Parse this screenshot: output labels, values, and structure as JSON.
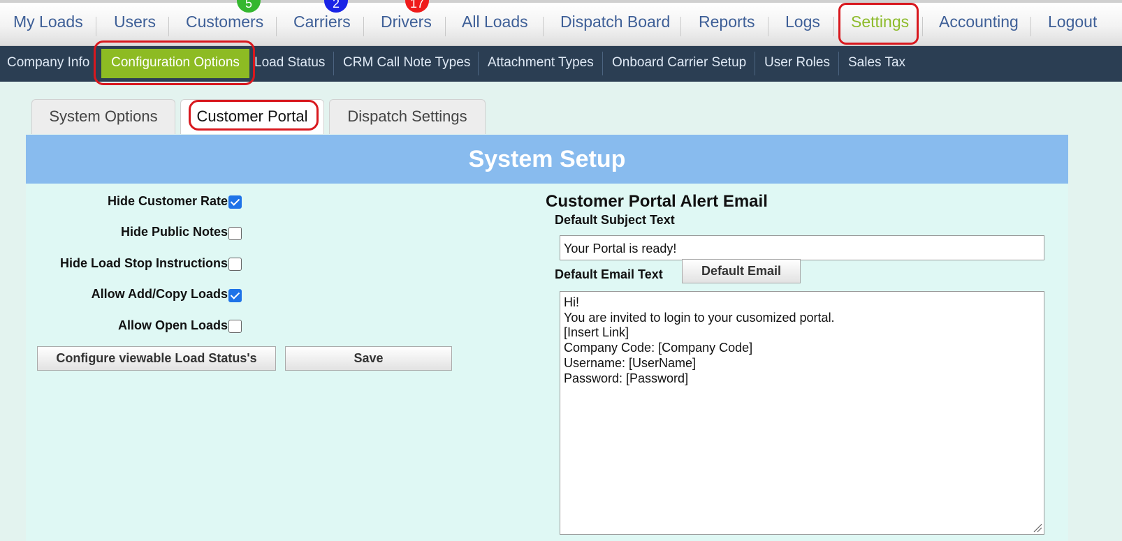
{
  "top_nav": {
    "items": [
      "My Loads",
      "Users",
      "Customers",
      "Carriers",
      "Drivers",
      "All Loads",
      "Dispatch Board",
      "Reports",
      "Logs",
      "Settings",
      "Accounting",
      "Logout"
    ],
    "badges": {
      "customers": "5",
      "carriers": "2",
      "drivers": "17"
    },
    "active": "Settings"
  },
  "sub_nav": {
    "items": [
      "Company Info",
      "Configuration Options",
      "Load Status",
      "CRM Call Note Types",
      "Attachment Types",
      "Onboard Carrier Setup",
      "User Roles",
      "Sales Tax"
    ],
    "active": "Configuration Options"
  },
  "tabs": [
    "System Options",
    "Customer Portal",
    "Dispatch Settings"
  ],
  "active_tab": "Customer Portal",
  "panel": {
    "title": "System Setup",
    "options": [
      {
        "label": "Hide Customer Rate",
        "checked": true
      },
      {
        "label": "Hide Public Notes",
        "checked": false
      },
      {
        "label": "Hide Load Stop Instructions",
        "checked": false
      },
      {
        "label": "Allow Add/Copy Loads",
        "checked": true
      },
      {
        "label": "Allow Open Loads",
        "checked": false
      }
    ],
    "configure_button": "Configure viewable Load Status's",
    "save_button": "Save",
    "alert_email": {
      "heading": "Customer Portal Alert Email",
      "subject_label": "Default Subject Text",
      "subject_value": "Your Portal is ready!",
      "email_label": "Default Email Text",
      "default_email_button": "Default Email",
      "email_lines": [
        "Hi!",
        "You are invited to login to your cusomized portal.",
        "[Insert Link]",
        "Company Code: [Company Code]",
        "Username: [UserName]",
        "Password: [Password]"
      ]
    }
  },
  "colors": {
    "nav_link": "#3e5f97",
    "active_green": "#8dbb23",
    "subnav_bg": "#2b3e53",
    "panel_header": "#88bbee",
    "panel_bg": "#dff8f4",
    "highlight": "#d8181e"
  }
}
